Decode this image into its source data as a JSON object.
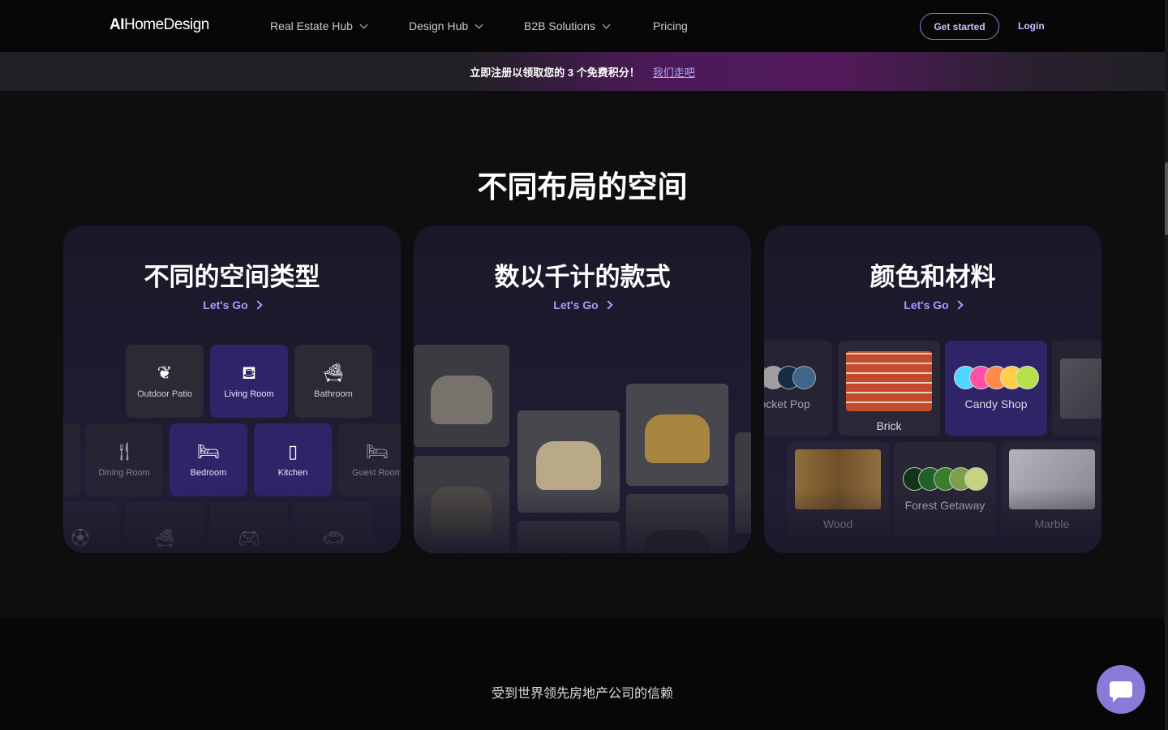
{
  "nav": {
    "logo": "AI HomeDesign",
    "logo_ai": "AI",
    "logo_rest": "HomeDesign",
    "items": [
      {
        "label": "Real Estate Hub"
      },
      {
        "label": "Design Hub"
      },
      {
        "label": "B2B Solutions"
      },
      {
        "label": "Pricing"
      }
    ],
    "get_started": "Get started",
    "login": "Login"
  },
  "banner": {
    "text": "立即注册以领取您的 3 个免费积分！",
    "link": "我们走吧"
  },
  "section": {
    "title": "不同布局的空间"
  },
  "cards": [
    {
      "title": "不同的空间类型",
      "link": "Let's Go"
    },
    {
      "title": "数以千计的款式",
      "link": "Let's Go"
    },
    {
      "title": "颜色和材料",
      "link": "Let's Go"
    }
  ],
  "rooms": [
    {
      "label": "Outdoor Patio",
      "icon": "plant-icon",
      "selected": false
    },
    {
      "label": "Living Room",
      "icon": "sofa-icon",
      "selected": true
    },
    {
      "label": "Bathroom",
      "icon": "bathtub-icon",
      "selected": false
    },
    {
      "label": "Dining Room",
      "icon": "fork-knife-icon",
      "selected": false
    },
    {
      "label": "Bedroom",
      "icon": "bed-icon",
      "selected": true
    },
    {
      "label": "Kitchen",
      "icon": "fridge-icon",
      "selected": true
    },
    {
      "label": "Guest Room",
      "icon": "double-bed-icon",
      "selected": false
    }
  ],
  "materials": [
    {
      "label": "Pocket Pop",
      "colors": [
        "#8a2a5a",
        "#d8d6d2",
        "#0f3550",
        "#4e86b0"
      ]
    },
    {
      "label": "Brick"
    },
    {
      "label": "Candy Shop",
      "colors": [
        "#4fd3ff",
        "#ff4fa8",
        "#ff8a4a",
        "#ffcf4a",
        "#b8e04a"
      ],
      "selected": true
    },
    {
      "label": "Wood"
    },
    {
      "label": "Forest Getaway",
      "colors": [
        "#0f3a12",
        "#226b2a",
        "#3f8f2a",
        "#8ab84e",
        "#e2f58a"
      ]
    },
    {
      "label": "Marble"
    }
  ],
  "footer": {
    "trust": "受到世界领先房地产公司的信赖"
  },
  "colors": {
    "accent": "#8b80e8",
    "selected_tile": "#2f2468",
    "chat": "#8a7ad8"
  }
}
